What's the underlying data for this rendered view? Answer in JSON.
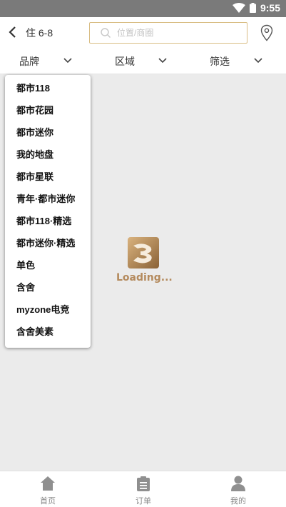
{
  "status_bar": {
    "time": "9:55",
    "icons": [
      "wifi-icon",
      "battery-icon"
    ]
  },
  "header": {
    "dates": "住 6-8",
    "search": {
      "placeholder": "位置/商圈",
      "value": ""
    }
  },
  "filters": [
    {
      "label": "品牌"
    },
    {
      "label": "区域"
    },
    {
      "label": "筛选"
    }
  ],
  "brand_dropdown": {
    "items": [
      "都市118",
      "都市花园",
      "都市迷你",
      "我的地盘",
      "都市星联",
      "青年·都市迷你",
      "都市118·精选",
      "都市迷你·精选",
      "单色",
      "含舍",
      "myzone电竞",
      "含舍美素"
    ]
  },
  "loading": {
    "text": "Loading..."
  },
  "tabbar": {
    "tabs": [
      {
        "label": "首页",
        "icon": "home-icon"
      },
      {
        "label": "订单",
        "icon": "order-icon"
      },
      {
        "label": "我的",
        "icon": "user-icon"
      }
    ]
  },
  "colors": {
    "accent": "#b48a5d",
    "search_border": "#d9bd84",
    "status_bar": "#7a7a7a",
    "background": "#ebebeb"
  }
}
